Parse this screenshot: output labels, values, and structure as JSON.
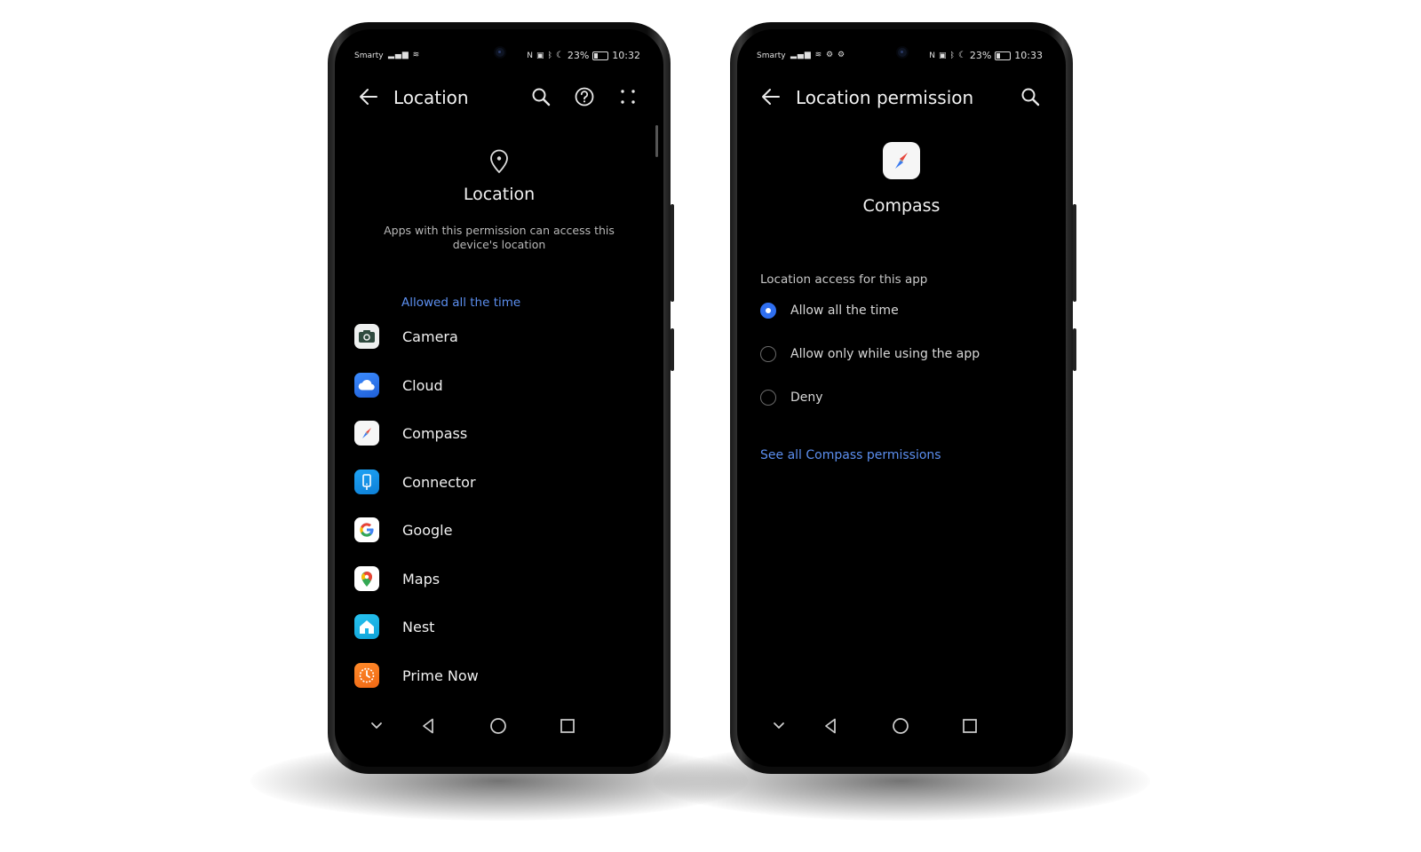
{
  "phone_left": {
    "status": {
      "carrier": "Smarty",
      "battery": "23%",
      "time": "10:32"
    },
    "header": {
      "title": "Location"
    },
    "hero": {
      "title": "Location",
      "description": "Apps with this permission can access this device's location"
    },
    "section_label": "Allowed all the time",
    "apps": [
      {
        "name": "Camera",
        "icon": "camera-icon"
      },
      {
        "name": "Cloud",
        "icon": "cloud-icon"
      },
      {
        "name": "Compass",
        "icon": "compass-icon"
      },
      {
        "name": "Connector",
        "icon": "connector-icon"
      },
      {
        "name": "Google",
        "icon": "google-icon"
      },
      {
        "name": "Maps",
        "icon": "maps-icon"
      },
      {
        "name": "Nest",
        "icon": "nest-icon"
      },
      {
        "name": "Prime Now",
        "icon": "prime-now-icon"
      }
    ]
  },
  "phone_right": {
    "status": {
      "carrier": "Smarty",
      "battery": "23%",
      "time": "10:33"
    },
    "header": {
      "title": "Location permission"
    },
    "app": {
      "name": "Compass"
    },
    "permission": {
      "title": "Location access for this app",
      "options": [
        {
          "label": "Allow all the time",
          "selected": true
        },
        {
          "label": "Allow only while using the app",
          "selected": false
        },
        {
          "label": "Deny",
          "selected": false
        }
      ],
      "link": "See all Compass permissions"
    }
  },
  "colors": {
    "accent": "#5c8ff0",
    "radio_selected": "#2f6ff0",
    "screen_bg": "#000000"
  }
}
